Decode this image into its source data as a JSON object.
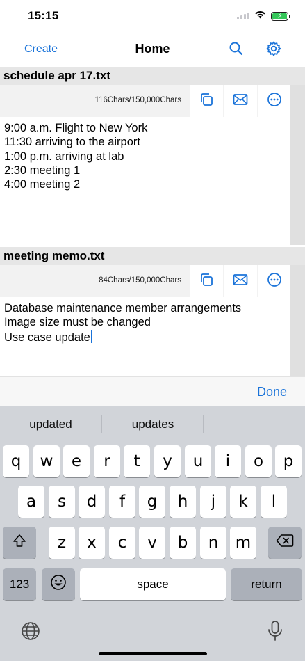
{
  "status": {
    "time": "15:15"
  },
  "nav": {
    "create_label": "Create",
    "title": "Home",
    "search_icon": "search-icon",
    "settings_icon": "gear-icon"
  },
  "colors": {
    "accent": "#1a73d9",
    "battery": "#34c759",
    "keyboard_bg": "#d1d4d9",
    "title_bar_bg": "#e6e6e6"
  },
  "documents": [
    {
      "title": "schedule apr 17.txt",
      "char_count": "116Chars/150,000Chars",
      "text": "9:00 a.m. Flight to New York\n11:30 arriving to the airport\n1:00 p.m. arriving at lab\n2:30 meeting 1\n4:00 meeting 2",
      "tools": [
        "copy-icon",
        "mail-icon",
        "more-icon"
      ]
    },
    {
      "title": "meeting memo.txt",
      "char_count": "84Chars/150,000Chars",
      "text": "Database maintenance member arrangements\nImage size must be changed\nUse case update",
      "tools": [
        "copy-icon",
        "mail-icon",
        "more-icon"
      ]
    }
  ],
  "accessory": {
    "done_label": "Done"
  },
  "keyboard": {
    "suggestions": [
      "updated",
      "updates",
      ""
    ],
    "row1": [
      "q",
      "w",
      "e",
      "r",
      "t",
      "y",
      "u",
      "i",
      "o",
      "p"
    ],
    "row2": [
      "a",
      "s",
      "d",
      "f",
      "g",
      "h",
      "j",
      "k",
      "l"
    ],
    "row3": [
      "z",
      "x",
      "c",
      "v",
      "b",
      "n",
      "m"
    ],
    "numbers_label": "123",
    "space_label": "space",
    "return_label": "return"
  }
}
